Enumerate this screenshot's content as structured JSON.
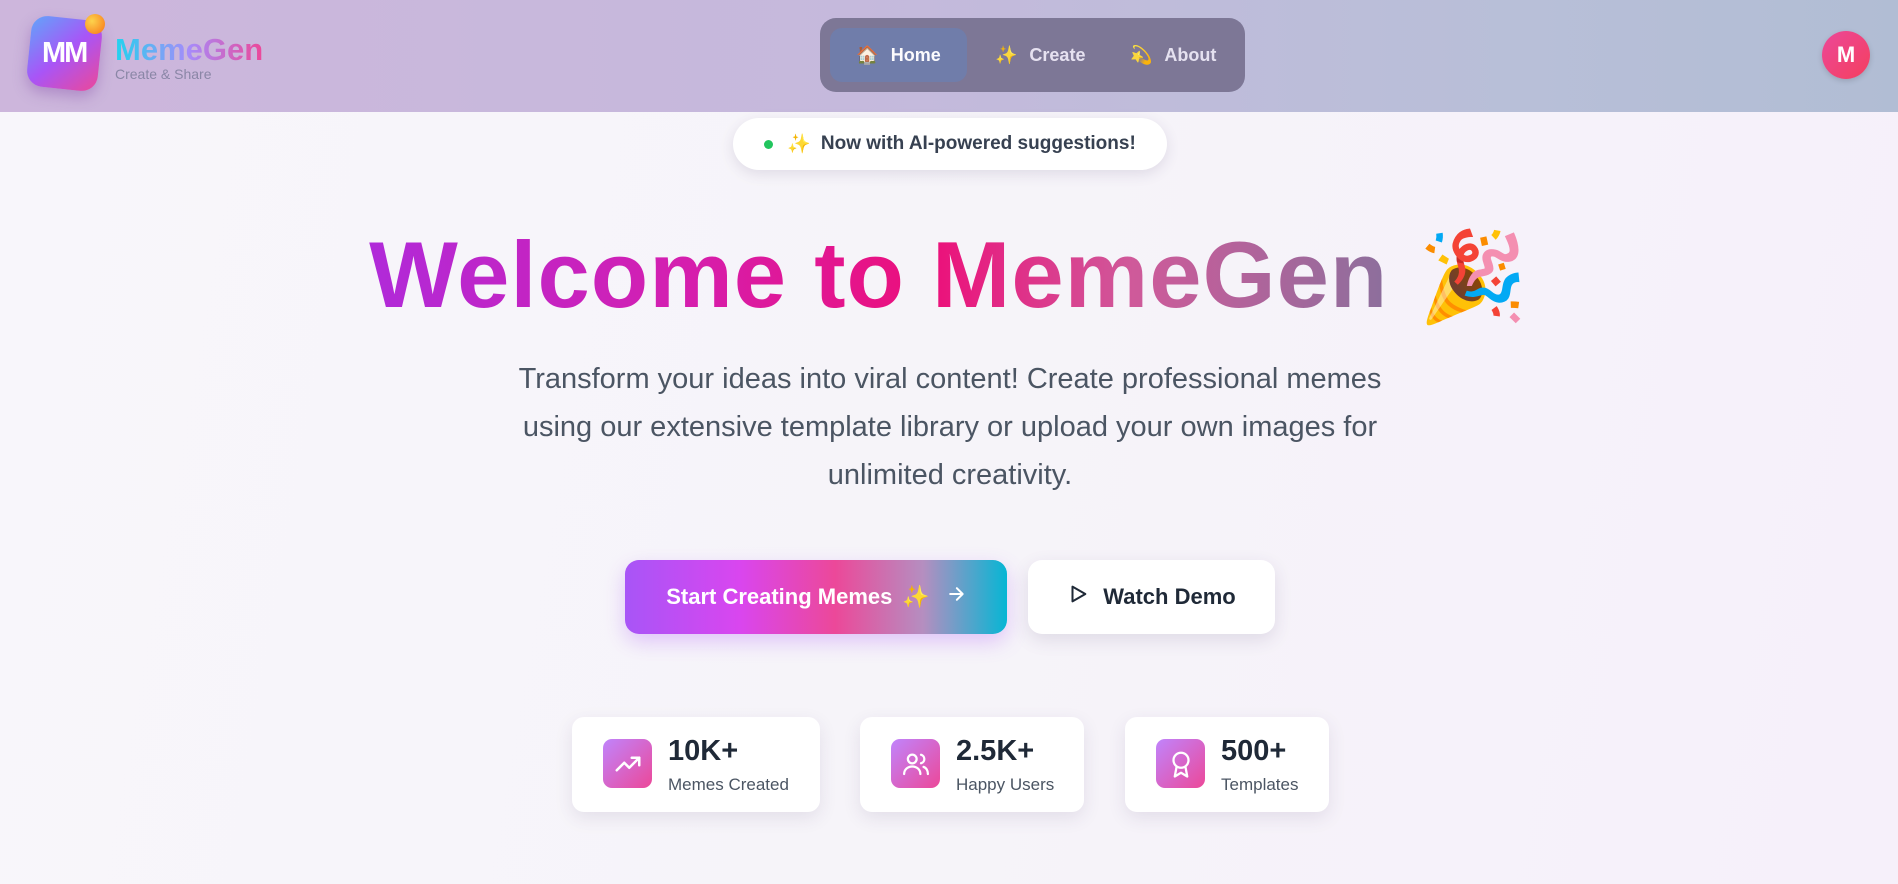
{
  "header": {
    "logo_text": "MM",
    "brand_name": "MemeGen",
    "tagline": "Create & Share",
    "nav": [
      {
        "label": "Home",
        "icon": "🏠",
        "active": true
      },
      {
        "label": "Create",
        "icon": "✨",
        "active": false
      },
      {
        "label": "About",
        "icon": "💫",
        "active": false
      }
    ],
    "avatar_initial": "M"
  },
  "announcement": {
    "icon": "✨",
    "text": "Now with AI-powered suggestions!"
  },
  "hero": {
    "title_plain": "Welcome to ",
    "title_brand": "MemeGen",
    "title_emoji": "🎉",
    "subtitle": "Transform your ideas into viral content! Create professional memes using our extensive template library or upload your own images for unlimited creativity."
  },
  "actions": {
    "primary_label": "Start Creating Memes",
    "primary_icon": "✨",
    "secondary_label": "Watch Demo"
  },
  "stats": [
    {
      "value": "10K+",
      "label": "Memes Created",
      "icon": "trending-up-icon"
    },
    {
      "value": "2.5K+",
      "label": "Happy Users",
      "icon": "users-icon"
    },
    {
      "value": "500+",
      "label": "Templates",
      "icon": "award-icon"
    }
  ],
  "colors": {
    "accent_purple": "#a855f7",
    "accent_pink": "#ec4899",
    "accent_cyan": "#06b6d4",
    "status_green": "#22c55e"
  }
}
